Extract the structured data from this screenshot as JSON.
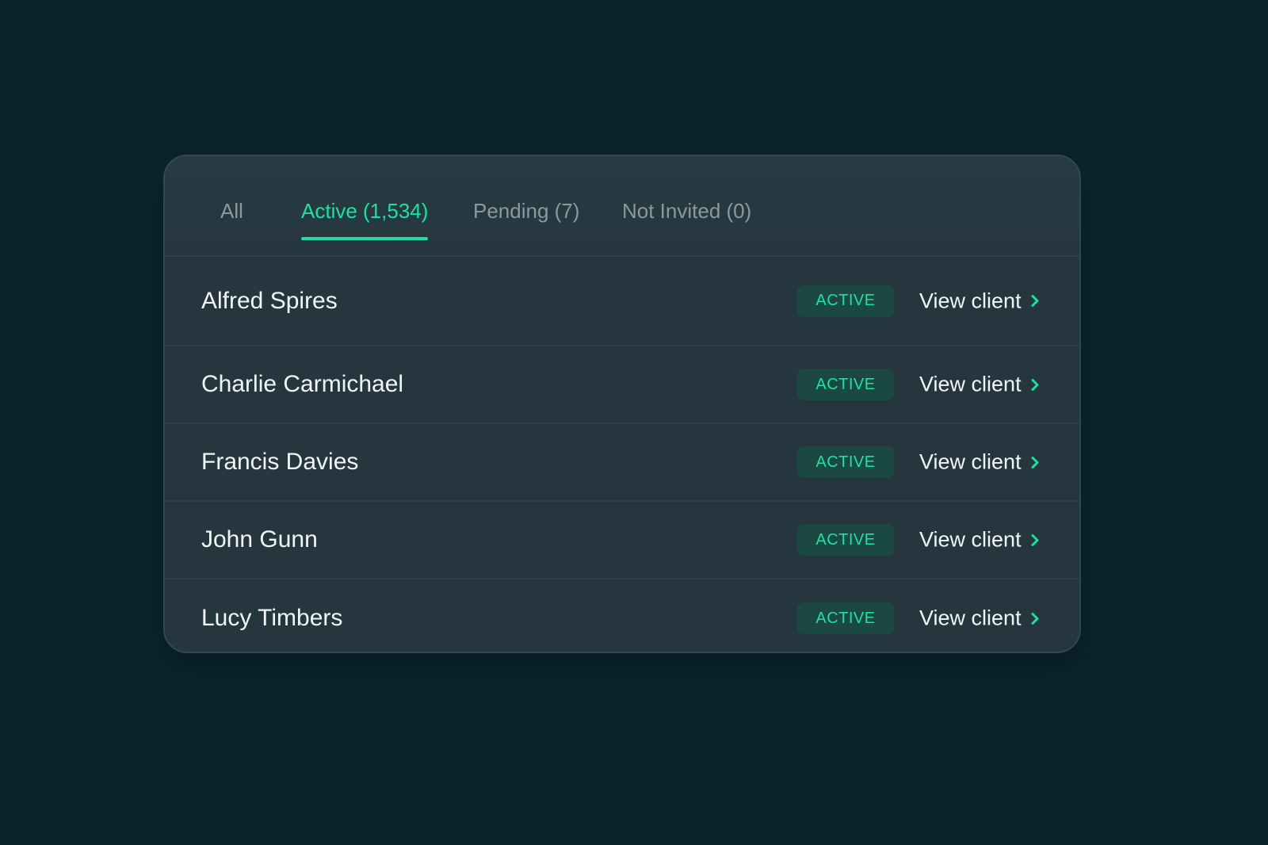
{
  "tabs": [
    {
      "label": "All",
      "active": false
    },
    {
      "label": "Active (1,534)",
      "active": true
    },
    {
      "label": "Pending (7)",
      "active": false
    },
    {
      "label": "Not Invited (0)",
      "active": false
    }
  ],
  "clients": [
    {
      "name": "Alfred Spires",
      "status": "ACTIVE",
      "action": "View client"
    },
    {
      "name": "Charlie Carmichael",
      "status": "ACTIVE",
      "action": "View client"
    },
    {
      "name": "Francis Davies",
      "status": "ACTIVE",
      "action": "View client"
    },
    {
      "name": "John Gunn",
      "status": "ACTIVE",
      "action": "View client"
    },
    {
      "name": "Lucy Timbers",
      "status": "ACTIVE",
      "action": "View client"
    }
  ],
  "colors": {
    "background": "#0a242e",
    "card": "#25363e",
    "accent": "#1ee0a6",
    "badge_bg": "#1b4840",
    "text_primary": "#f1f5f6",
    "text_muted": "#8c999e"
  },
  "icons": {
    "row_action": "chevron-right-icon"
  }
}
